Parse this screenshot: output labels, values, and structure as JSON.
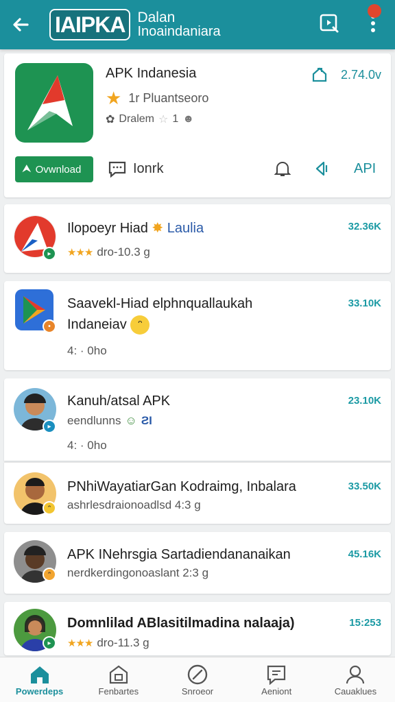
{
  "header": {
    "logo_text": "IAIPKA",
    "subtitle_line1": "Dalan",
    "subtitle_line2": "Inoaindaniara",
    "notification_count": ""
  },
  "featured": {
    "title": "APK Indanesia",
    "version": "2.74.0v",
    "rating_text": "1r Pluantseoro",
    "meta_text": "Dralem",
    "meta_count": "1",
    "download_label": "Ovwnload",
    "comment_label": "Ionrk",
    "api_label": "API"
  },
  "items": [
    {
      "title": "Ilopoeyr Hiad",
      "title_suffix": "Laulia",
      "sub": "dro-10.3 g",
      "stars": "★★★",
      "size": "32.36K"
    },
    {
      "title": "Saavekl-Hiad elphnquallaukah",
      "title_line2": "Indaneiav",
      "sub": "4: · 0ho",
      "size": "33.10K"
    },
    {
      "title": "Kanuh/atsal APK",
      "sub_line1": "eendlunns",
      "sub": "4: · 0ho",
      "size": "23.10K"
    },
    {
      "title": "PNhiWayatiarGan Kodraimg, Inbalara",
      "sub": "ashrlesdraionoadlsd  4:3 g",
      "size": "33.50K"
    },
    {
      "title": "APK INehrsgia Sartadiendananaikan",
      "sub": "nerdkerdingonoaslant  2:3 g",
      "size": "45.16K"
    },
    {
      "title": "Domnlilad ABlasitilmadina nalaaja)",
      "sub": "dro-11.3 g",
      "stars": "★★★",
      "size": "15:253"
    }
  ],
  "nav": [
    {
      "label": "Powerdeps",
      "icon": "home-icon"
    },
    {
      "label": "Fenbartes",
      "icon": "store-icon"
    },
    {
      "label": "Snroeor",
      "icon": "compass-icon"
    },
    {
      "label": "Aeniont",
      "icon": "chat-icon"
    },
    {
      "label": "Cauaklues",
      "icon": "profile-icon"
    }
  ],
  "colors": {
    "primary": "#1b8f9c",
    "accent_green": "#1e9352",
    "star": "#f1a520",
    "notification": "#e0462e"
  }
}
